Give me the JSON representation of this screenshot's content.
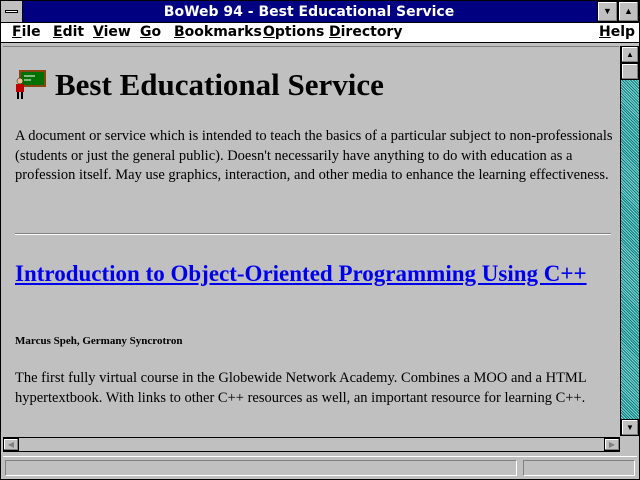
{
  "window": {
    "title": "BoWeb 94 - Best Educational Service"
  },
  "menu": [
    {
      "pre": "",
      "key": "F",
      "post": "ile"
    },
    {
      "pre": "",
      "key": "E",
      "post": "dit"
    },
    {
      "pre": "",
      "key": "V",
      "post": "iew"
    },
    {
      "pre": "",
      "key": "G",
      "post": "o"
    },
    {
      "pre": "",
      "key": "B",
      "post": "ookmarks"
    },
    {
      "pre": "",
      "key": "O",
      "post": "ptions"
    },
    {
      "pre": "",
      "key": "D",
      "post": "irectory"
    },
    {
      "pre": "",
      "key": "H",
      "post": "elp"
    }
  ],
  "page": {
    "title": "Best Educational Service",
    "intro": "A document or service which is intended to teach the basics of a particular subject to non-professionals (students or just the general public). Doesn't necessarily have anything to do with education as a profession itself. May use graphics, interaction, and other media to enhance the learning effectiveness.",
    "entry": {
      "link": "Introduction to Object-Oriented Programming Using C++",
      "author": "Marcus Speh, Germany Syncrotron",
      "description": "The first fully virtual course in the Globewide Network Academy. Combines a MOO and a HTML hypertextbook. With links to other C++ resources as well, an important resource for learning C++."
    }
  },
  "colors": {
    "titlebar": "#000080",
    "link": "#0000ee",
    "scroll_track": "#008080"
  },
  "icons": {
    "system_menu": "system-menu-icon",
    "minimize": "down-triangle",
    "maximize": "up-triangle"
  }
}
